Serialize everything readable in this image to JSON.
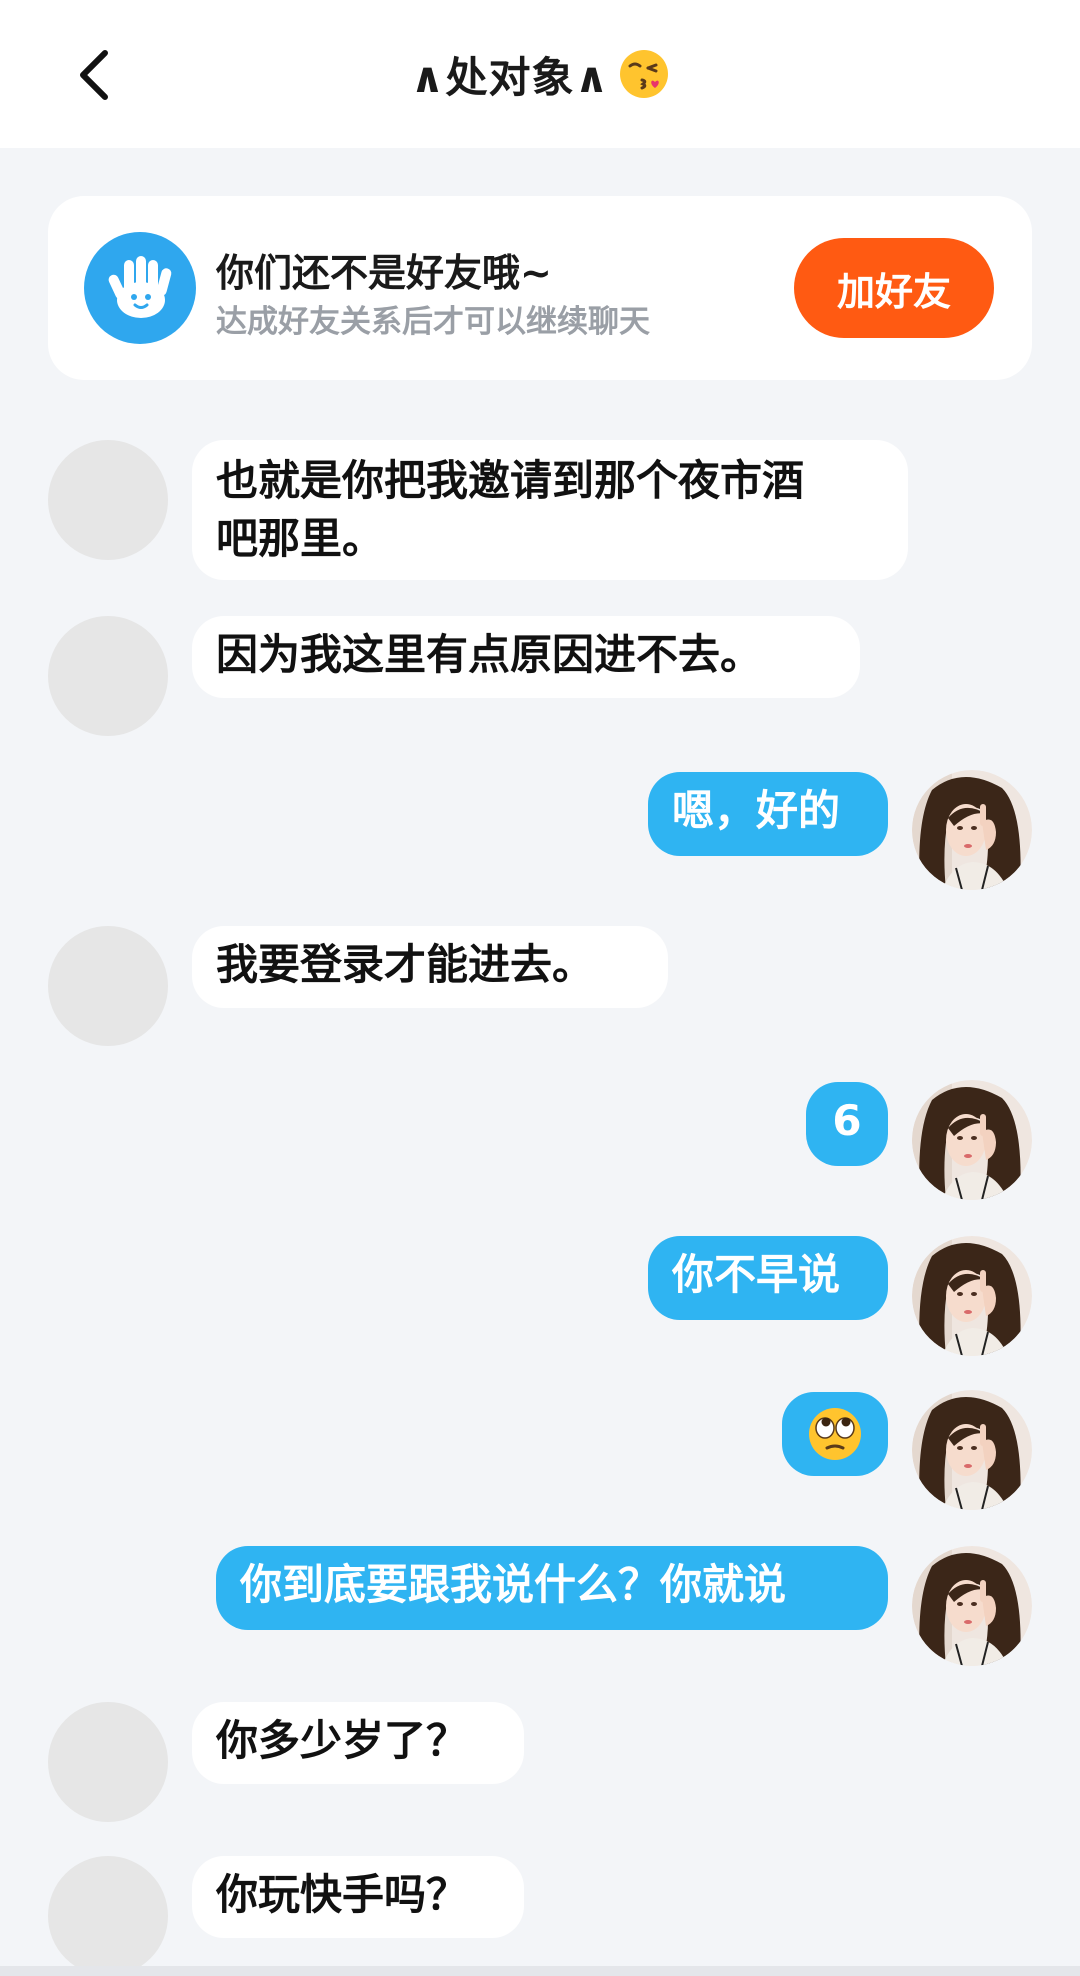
{
  "header": {
    "title": "∧处对象∧",
    "title_emoji": "face-blowing-kiss-emoji"
  },
  "notice": {
    "title": "你们还不是好友哦~",
    "subtitle": "达成好友关系后才可以继续聊天",
    "add_friend_label": "加好友",
    "icon": "waving-hand-icon"
  },
  "colors": {
    "accent_blue": "#2fb4f2",
    "add_friend_orange": "#ff5a12",
    "background": "#f3f5f8"
  },
  "messages": [
    {
      "side": "in",
      "lines": [
        "也就是你把我邀请到那个夜市酒",
        "吧那里。"
      ]
    },
    {
      "side": "in",
      "lines": [
        "因为我这里有点原因进不去。"
      ]
    },
    {
      "side": "out",
      "lines": [
        "嗯，好的"
      ]
    },
    {
      "side": "in",
      "lines": [
        "我要登录才能进去。"
      ]
    },
    {
      "side": "out",
      "lines": [
        "6"
      ]
    },
    {
      "side": "out",
      "lines": [
        "你不早说"
      ]
    },
    {
      "side": "out",
      "emoji": "face-with-rolling-eyes-emoji"
    },
    {
      "side": "out",
      "lines": [
        "你到底要跟我说什么？你就说"
      ]
    },
    {
      "side": "in",
      "lines": [
        "你多少岁了？"
      ]
    },
    {
      "side": "in",
      "lines": [
        "你玩快手吗？"
      ]
    }
  ]
}
